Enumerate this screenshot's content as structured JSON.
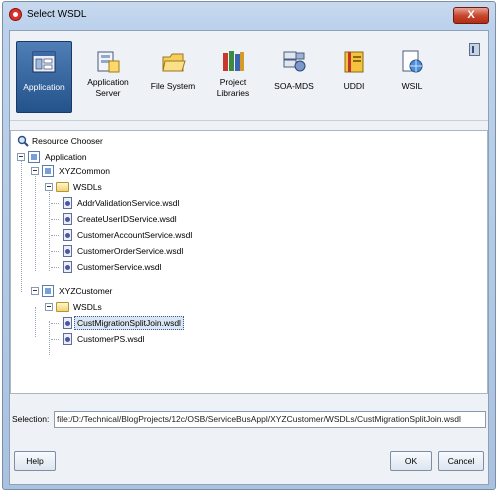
{
  "window": {
    "title": "Select WSDL",
    "close_label": "X"
  },
  "toolbar": {
    "items": [
      {
        "label": "Application",
        "icon": "application-icon"
      },
      {
        "label": "Application\nServer",
        "icon": "application-server-icon"
      },
      {
        "label": "File System",
        "icon": "file-system-icon"
      },
      {
        "label": "Project\nLibraries",
        "icon": "project-libraries-icon"
      },
      {
        "label": "SOA-MDS",
        "icon": "soa-mds-icon"
      },
      {
        "label": "UDDI",
        "icon": "uddi-icon"
      },
      {
        "label": "WSIL",
        "icon": "wsil-icon"
      }
    ]
  },
  "tree": {
    "root": "Resource Chooser",
    "application": "Application",
    "project1": "XYZCommon",
    "folder1": "WSDLs",
    "files1": [
      "AddrValidationService.wsdl",
      "CreateUserIDService.wsdl",
      "CustomerAccountService.wsdl",
      "CustomerOrderService.wsdl",
      "CustomerService.wsdl"
    ],
    "project2": "XYZCustomer",
    "folder2": "WSDLs",
    "files2": [
      "CustMigrationSplitJoin.wsdl",
      "CustomerPS.wsdl"
    ]
  },
  "selection": {
    "label": "Selection:",
    "value": "file:/D:/Technical/BlogProjects/12c/OSB/ServiceBusAppl/XYZCustomer/WSDLs/CustMigrationSplitJoin.wsdl"
  },
  "buttons": {
    "help": "Help",
    "ok": "OK",
    "cancel": "Cancel"
  },
  "colors": {
    "selected_toolbar": "#2f5f9a",
    "title_bar": "#bcd2ec",
    "close": "#c8472f"
  }
}
